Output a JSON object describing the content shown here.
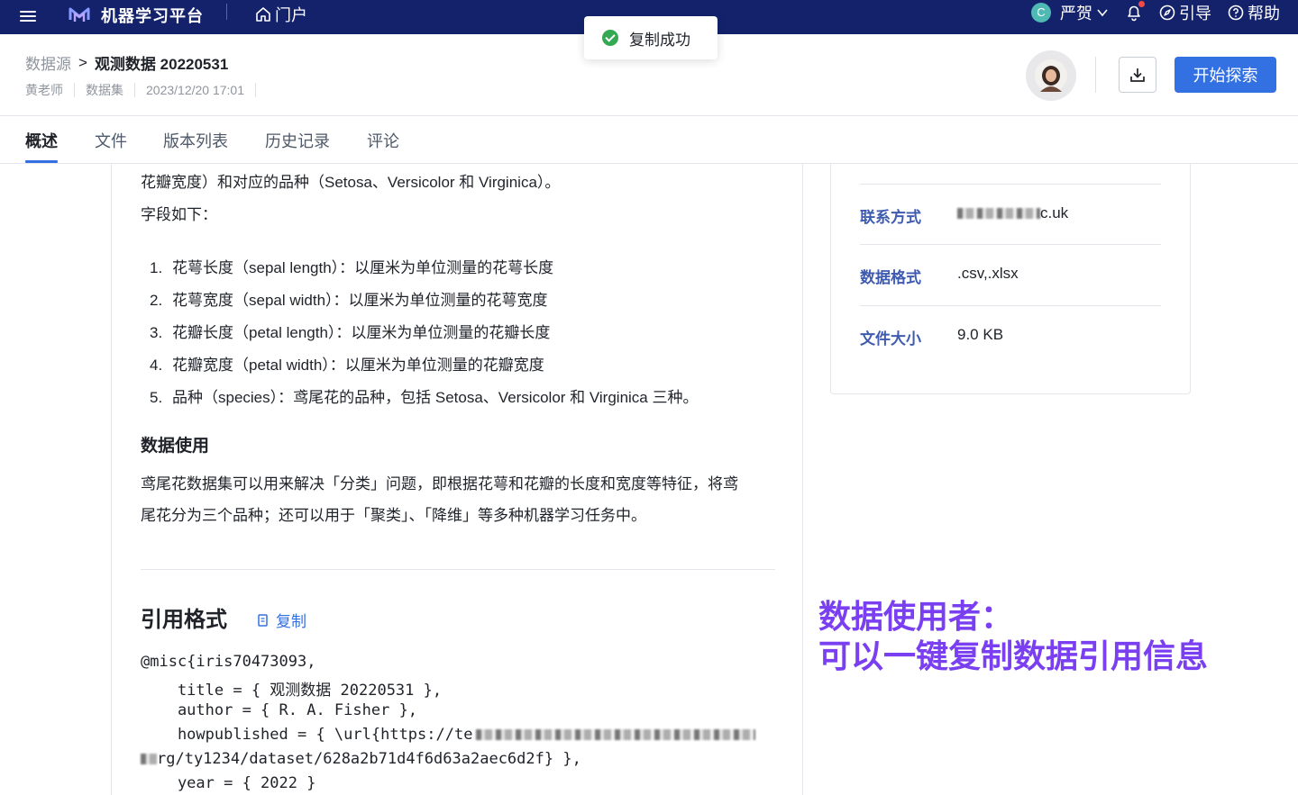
{
  "topbar": {
    "app_title": "机器学习平台",
    "portal_label": "门户",
    "user_initial": "C",
    "user_name": "严贺",
    "guide_label": "引导",
    "help_label": "帮助"
  },
  "toast": {
    "message": "复制成功"
  },
  "header": {
    "breadcrumb_root": "数据源",
    "breadcrumb_sep": ">",
    "breadcrumb_current": "观测数据 20220531",
    "meta": [
      "黄老师",
      "数据集",
      "2023/12/20 17:01"
    ],
    "explore_label": "开始探索"
  },
  "tabs": [
    "概述",
    "文件",
    "版本列表",
    "历史记录",
    "评论"
  ],
  "content": {
    "line_intro": "花瓣宽度）和对应的品种（Setosa、Versicolor 和 Virginica）。",
    "fields_intro": "字段如下：",
    "fields": [
      "花萼长度（sepal length）：以厘米为单位测量的花萼长度",
      "花萼宽度（sepal width）：以厘米为单位测量的花萼宽度",
      "花瓣长度（petal length）：以厘米为单位测量的花瓣长度",
      "花瓣宽度（petal width）：以厘米为单位测量的花瓣宽度",
      "品种（species）：鸢尾花的品种，包括 Setosa、Versicolor 和 Virginica 三种。"
    ],
    "usage_title": "数据使用",
    "usage_line1": "鸢尾花数据集可以用来解决「分类」问题，即根据花萼和花瓣的长度和宽度等特征，将鸢",
    "usage_line2": "尾花分为三个品种；还可以用于「聚类」、「降维」等多种机器学习任务中。",
    "cite_title": "引用格式",
    "copy_label": "复制",
    "code_lines": [
      "@misc{iris70473093,",
      "    title = { 观测数据 20220531 },",
      "    author = { R. A. Fisher },",
      "    howpublished = { \\url{https://te",
      "rg/ty1234/dataset/628a2b71d4f6d63a2aec6d2f} },",
      "    year = { 2022 }"
    ]
  },
  "info": {
    "rows": [
      {
        "label": "联系方式",
        "value": "c.uk"
      },
      {
        "label": "数据格式",
        "value": ".csv,.xlsx"
      },
      {
        "label": "文件大小",
        "value": "9.0 KB"
      }
    ]
  },
  "annotation": {
    "line1": "数据使用者：",
    "line2": "可以一键复制数据引用信息"
  },
  "colors": {
    "topbar": "#13226b",
    "accent": "#3370e1",
    "annotation": "#7a3ff0",
    "success": "#34a853"
  }
}
